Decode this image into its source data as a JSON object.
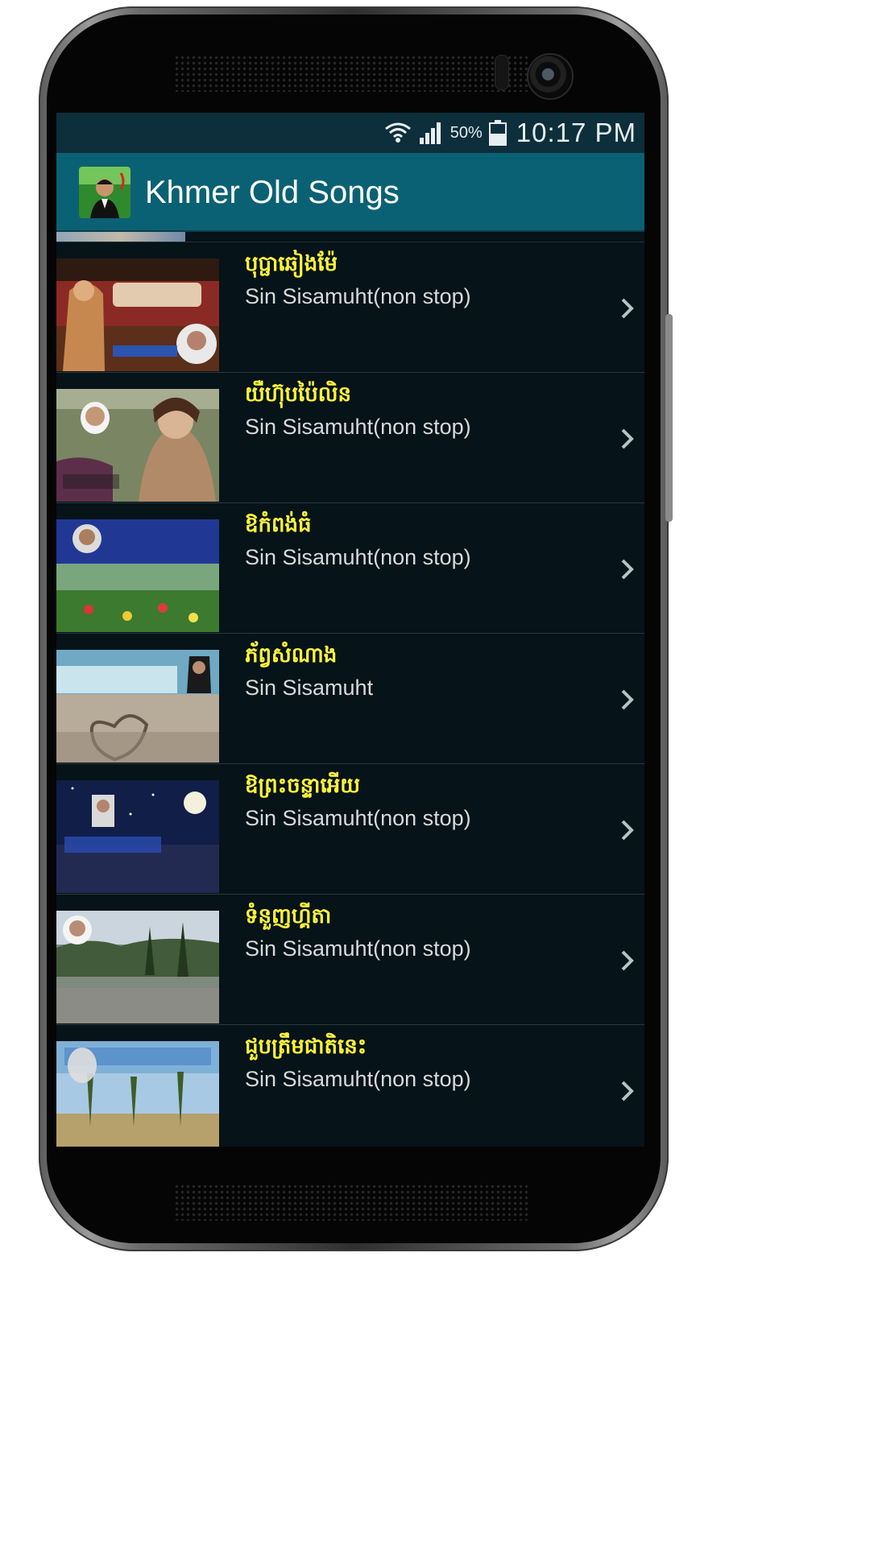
{
  "status_bar": {
    "battery_percent": "50%",
    "time": "10:17 PM",
    "icons": [
      "wifi-icon",
      "signal-icon",
      "battery-icon"
    ]
  },
  "app": {
    "title": "Khmer Old Songs",
    "icon": "app-logo"
  },
  "songs": [
    {
      "title": "បុប្ផាឆៀងម៉ែ",
      "artist": "Sin Sisamuht(non stop)"
    },
    {
      "title": "យឺហ៊ុបប៉ៃលិន",
      "artist": "Sin Sisamuht(non stop)"
    },
    {
      "title": "ឱកំពង់ធំ",
      "artist": "Sin Sisamuht(non stop)"
    },
    {
      "title": "ភ័ព្វសំណាង",
      "artist": "Sin Sisamuht"
    },
    {
      "title": "ឱព្រះចន្ទាអើយ",
      "artist": "Sin Sisamuht(non stop)"
    },
    {
      "title": "ទំនួញហ្គីតា",
      "artist": "Sin Sisamuht(non stop)"
    },
    {
      "title": "ជួបត្រឹមជាតិនេះ",
      "artist": "Sin Sisamuht(non stop)"
    }
  ],
  "colors": {
    "status_bar": "#0c2f3b",
    "action_bar": "#0b6174",
    "list_background": "#061318",
    "title_text": "#fff43a",
    "artist_text": "#d7dadb"
  }
}
